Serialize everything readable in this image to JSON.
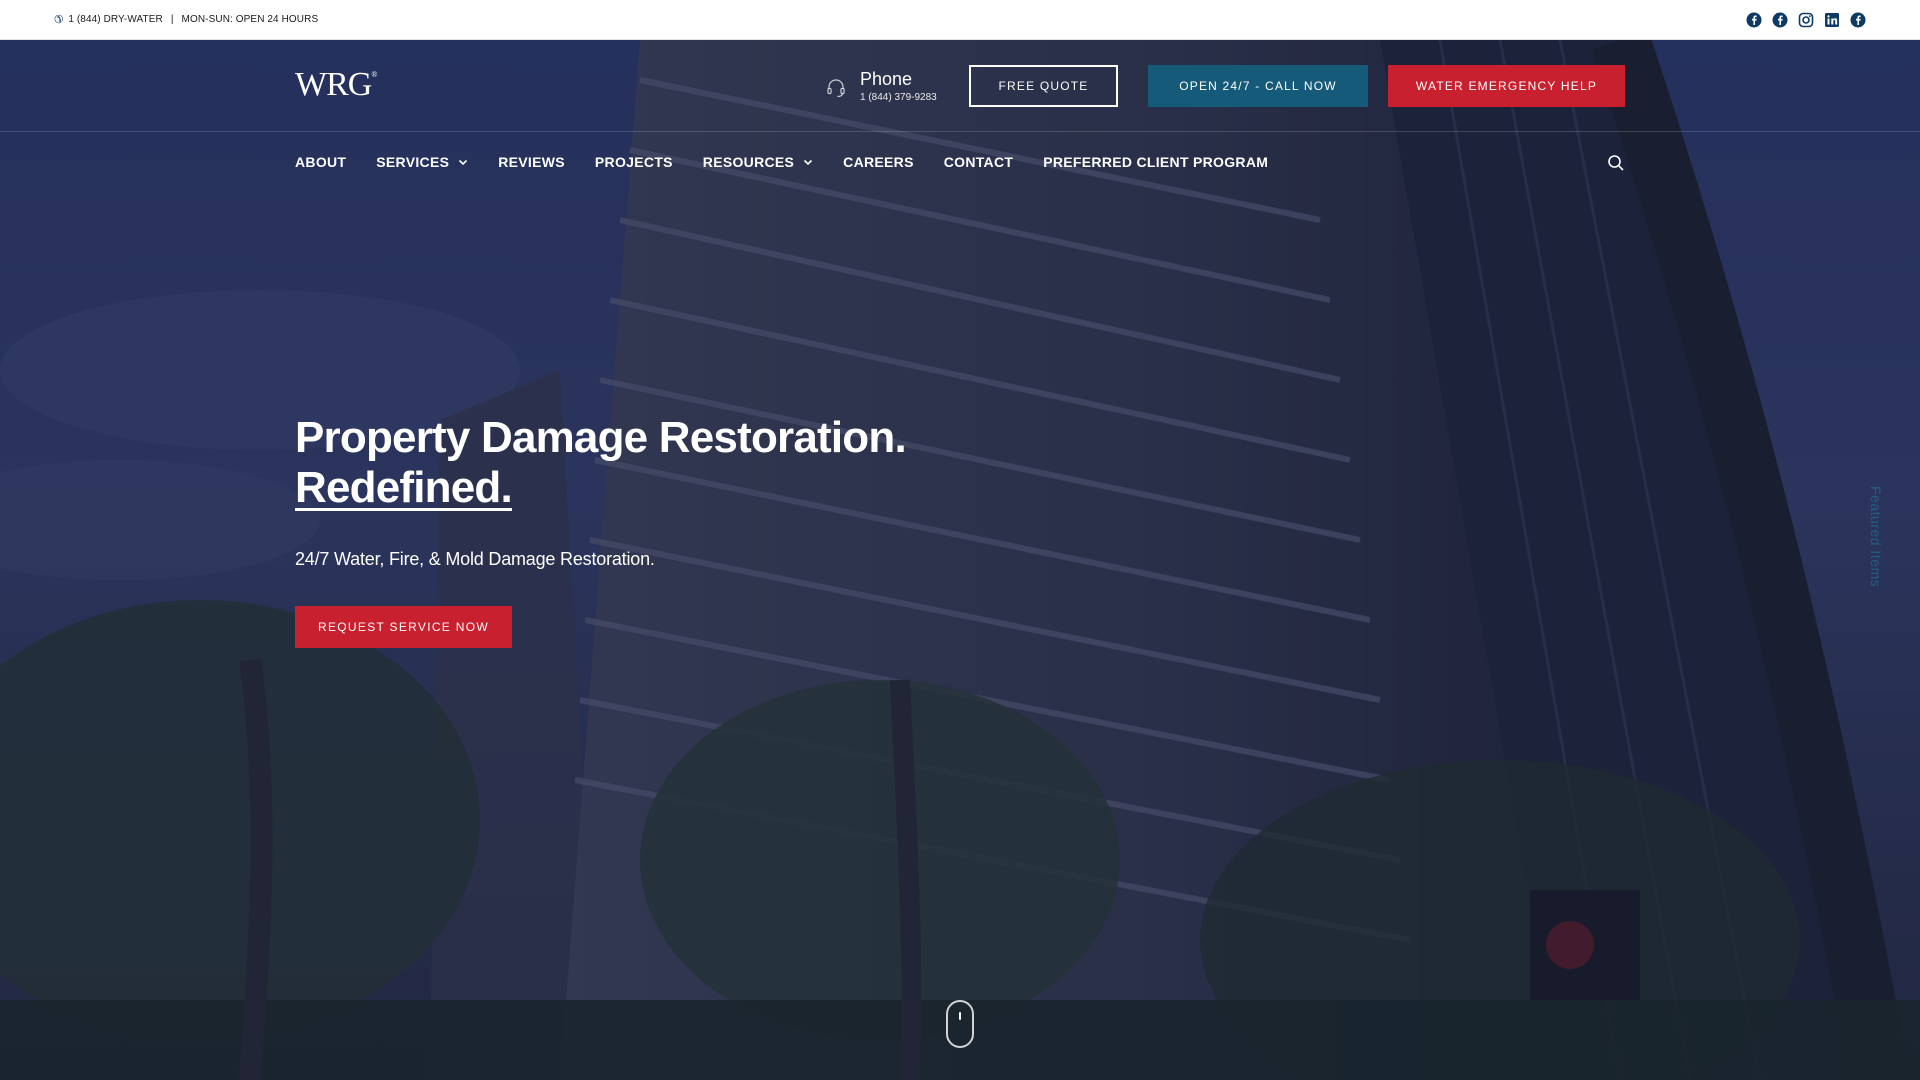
{
  "topbar": {
    "phone": "1 (844) DRY-WATER",
    "separator": "|",
    "hours": "MON-SUN: OPEN 24 HOURS",
    "socials": [
      "facebook-icon",
      "facebook-icon",
      "instagram-icon",
      "linkedin-icon",
      "facebook-icon"
    ]
  },
  "header": {
    "logo_text": "WRG",
    "logo_mark": "®",
    "phone_label": "Phone",
    "phone_number": "1 (844) 379-9283",
    "buttons": {
      "quote": "FREE QUOTE",
      "call": "OPEN 24/7 - CALL NOW",
      "emergency": "WATER EMERGENCY HELP"
    }
  },
  "nav": {
    "items": [
      {
        "label": "ABOUT"
      },
      {
        "label": "SERVICES"
      },
      {
        "label": "REVIEWS"
      },
      {
        "label": "PROJECTS"
      },
      {
        "label": "RESOURCES"
      },
      {
        "label": "CAREERS"
      },
      {
        "label": "CONTACT"
      },
      {
        "label": "PREFERRED CLIENT PROGRAM"
      }
    ]
  },
  "hero": {
    "title_line1": "Property Damage Restoration.",
    "title_line2": "Redefined.",
    "subtitle": "24/7 Water, Fire, & Mold Damage Restoration.",
    "cta": "REQUEST SERVICE NOW",
    "featured_tab": "Featured Items"
  },
  "colors": {
    "accent_red": "#c8202f",
    "accent_teal": "#155a78",
    "overlay_navy": "#161c3a"
  }
}
